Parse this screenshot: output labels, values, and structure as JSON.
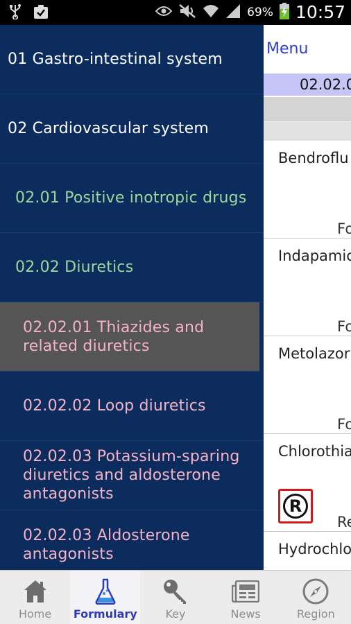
{
  "statusbar": {
    "icons_left": [
      "usb-icon",
      "clipboard-check-icon"
    ],
    "icons_right": [
      "eye-icon",
      "mute-icon",
      "wifi-icon",
      "signal-icon",
      "battery-charging-icon"
    ],
    "battery": "69%",
    "time": "10:57"
  },
  "content": {
    "menu_label": "Menu",
    "section_code": "02.02.0",
    "drugs": [
      {
        "name": "Bendroflu",
        "tag": "Fo"
      },
      {
        "name": "Indapamic",
        "tag": "Fo"
      },
      {
        "name": "Metolazor",
        "tag": "Fo"
      },
      {
        "name": "Chlorothia",
        "tag": "Re",
        "badge": "R"
      },
      {
        "name": "Hydrochlo",
        "tag": ""
      }
    ]
  },
  "drawer": {
    "items": [
      {
        "label": "01 Gastro-intestinal system",
        "level": 0
      },
      {
        "label": "02 Cardiovascular system",
        "level": 0
      },
      {
        "label": "02.01 Positive inotropic drugs",
        "level": 1
      },
      {
        "label": "02.02 Diuretics",
        "level": 1
      },
      {
        "label": "02.02.01 Thiazides and related diuretics",
        "level": 2,
        "selected": true
      },
      {
        "label": "02.02.02 Loop diuretics",
        "level": 2
      },
      {
        "label": "02.02.03 Potassium-sparing diuretics and aldosterone antagonists",
        "level": 2
      },
      {
        "label": "02.02.03 Aldosterone antagonists",
        "level": 2
      }
    ]
  },
  "tabs": [
    {
      "label": "Home",
      "icon": "home-icon"
    },
    {
      "label": "Formulary",
      "icon": "flask-icon",
      "active": true
    },
    {
      "label": "Key",
      "icon": "key-icon"
    },
    {
      "label": "News",
      "icon": "newspaper-icon"
    },
    {
      "label": "Region",
      "icon": "compass-icon"
    }
  ],
  "colors": {
    "drawer_bg": "#0b2c5c",
    "level0_text": "#ffffff",
    "level1_text": "#9fd59a",
    "level2_text": "#f4b3c6",
    "selected_bg": "#555555",
    "accent_blue": "#2e3ab8"
  }
}
